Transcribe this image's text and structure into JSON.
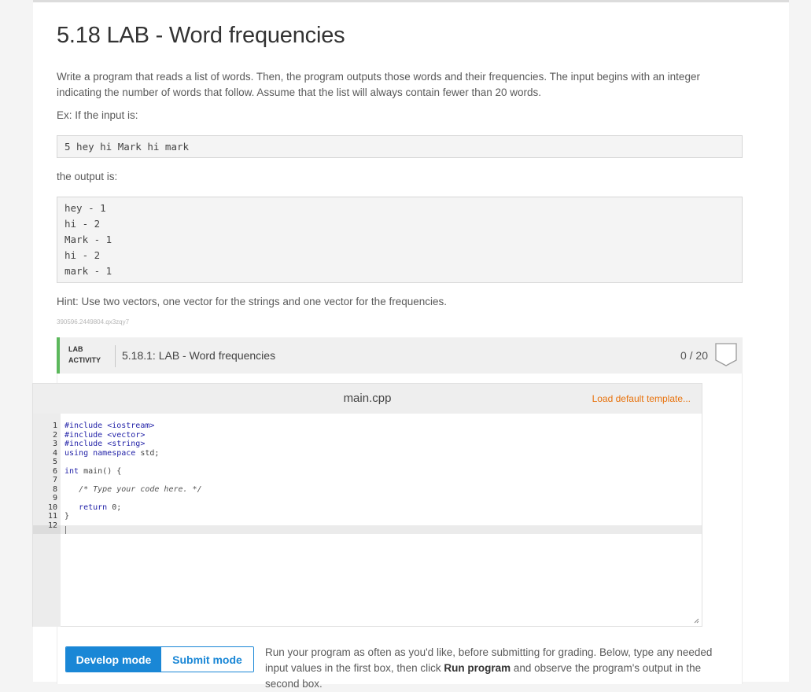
{
  "title": "5.18 LAB - Word frequencies",
  "description": "Write a program that reads a list of words. Then, the program outputs those words and their frequencies. The input begins with an integer indicating the number of words that follow. Assume that the list will always contain fewer than 20 words.",
  "example_label": "Ex: If the input is:",
  "example_input": "5 hey hi Mark hi mark",
  "output_label": "the output is:",
  "example_output": [
    "hey - 1",
    "hi - 2",
    "Mark - 1",
    "hi - 2",
    "mark - 1"
  ],
  "hint": "Hint: Use two vectors, one vector for the strings and one vector for the frequencies.",
  "hash_id": "390596.2449804.qx3zqy7",
  "lab": {
    "tag_line1": "LAB",
    "tag_line2": "ACTIVITY",
    "title": "5.18.1: LAB - Word frequencies",
    "score": "0 / 20"
  },
  "editor": {
    "filename": "main.cpp",
    "load_default": "Load default template...",
    "line_numbers": [
      "1",
      "2",
      "3",
      "4",
      "5",
      "6",
      "7",
      "8",
      "9",
      "10",
      "11",
      "12"
    ],
    "code": [
      {
        "pre": "#include ",
        "rest": "<iostream>",
        "kind": "include"
      },
      {
        "pre": "#include ",
        "rest": "<vector>",
        "kind": "include"
      },
      {
        "pre": "#include ",
        "rest": "<string>",
        "kind": "include"
      },
      {
        "pre": "using namespace ",
        "rest": "std;",
        "kind": "using"
      },
      {
        "pre": "",
        "rest": "",
        "kind": "blank"
      },
      {
        "pre": "int ",
        "rest": "main() {",
        "kind": "type"
      },
      {
        "pre": "",
        "rest": "",
        "kind": "blank"
      },
      {
        "pre": "   ",
        "rest": "/* Type your code here. */",
        "kind": "comment"
      },
      {
        "pre": "",
        "rest": "",
        "kind": "blank"
      },
      {
        "pre": "   return ",
        "rest": "0;",
        "kind": "return"
      },
      {
        "pre": "}",
        "rest": "",
        "kind": "plain"
      },
      {
        "pre": "",
        "rest": "",
        "kind": "blank"
      }
    ]
  },
  "modes": {
    "develop": "Develop mode",
    "submit": "Submit mode"
  },
  "run_text": {
    "part1": "Run your program as often as you'd like, before submitting for grading. Below, type any needed input values in the first box, then click ",
    "bold": "Run program",
    "part2": " and observe the program's output in the second box."
  },
  "colors": {
    "accent": "#1a87d6",
    "green_bar": "#5cb85c",
    "orange_link": "#e8720c"
  }
}
